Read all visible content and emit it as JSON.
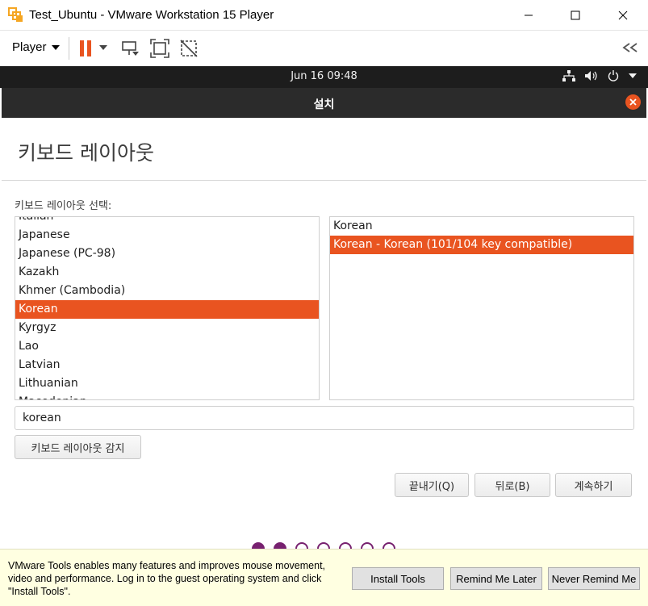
{
  "window": {
    "title": "Test_Ubuntu - VMware Workstation 15 Player"
  },
  "toolbar": {
    "player_menu": "Player",
    "icons": [
      "pause-icon",
      "dropdown-icon",
      "send-ctrl-alt-del-icon",
      "fullscreen-icon",
      "unity-icon",
      "collapse-icon"
    ],
    "pause_color": "#e95420"
  },
  "ubuntu_topbar": {
    "clock": "Jun 16  09:48",
    "tray_icons": [
      "network-icon",
      "volume-icon",
      "power-icon",
      "chevron-down-icon"
    ]
  },
  "installer": {
    "header_title": "설치",
    "page_title": "키보드 레이아웃",
    "section_label": "키보드 레이아웃 선택:",
    "layouts": [
      "Italian",
      "Japanese",
      "Japanese (PC-98)",
      "Kazakh",
      "Khmer (Cambodia)",
      "Korean",
      "Kyrgyz",
      "Lao",
      "Latvian",
      "Lithuanian",
      "Macedonian"
    ],
    "selected_layout": "Korean",
    "variants": [
      "Korean",
      "Korean - Korean (101/104 key compatible)"
    ],
    "selected_variant": "Korean - Korean (101/104 key compatible)",
    "search_value": "korean",
    "detect_button": "키보드 레이아웃 감지",
    "quit_button": "끝내기(Q)",
    "back_button": "뒤로(B)",
    "continue_button": "계속하기",
    "progress": {
      "completed": 2,
      "total": 7
    },
    "accent_color": "#e95420",
    "dot_color": "#77216f"
  },
  "vmware_tools": {
    "message": "VMware Tools enables many features and improves mouse movement, video and performance. Log in to the guest operating system and click \"Install Tools\".",
    "install_button": "Install Tools",
    "remind_button": "Remind Me Later",
    "never_button": "Never Remind Me"
  }
}
